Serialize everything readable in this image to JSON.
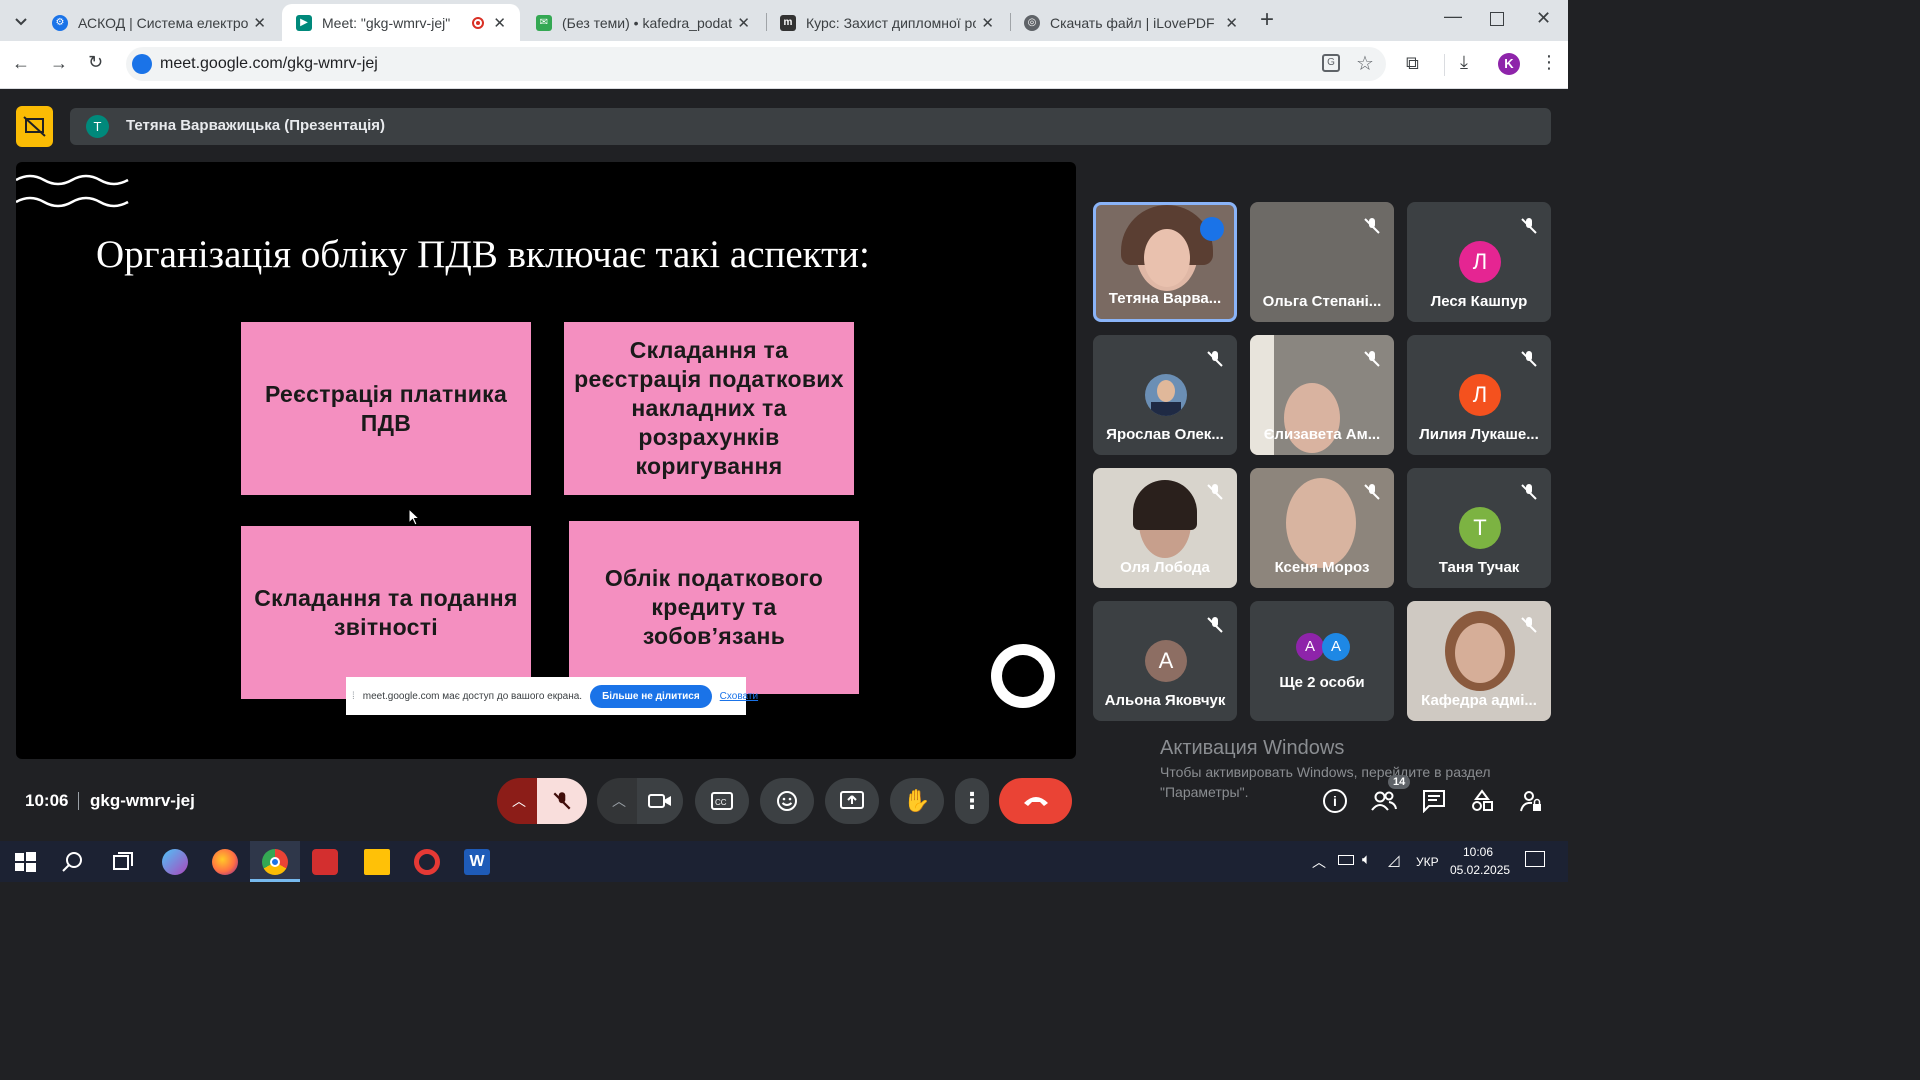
{
  "browser": {
    "tabs": [
      {
        "title": "АСКОД | Система електронног",
        "favicon": "gear-icon",
        "color": "#1a73e8"
      },
      {
        "title": "Meet: \"gkg-wmrv-jej\"",
        "favicon": "meet-icon",
        "color": "#00897b"
      },
      {
        "title": "(Без теми) • kafedra_podatky@",
        "favicon": "mail-icon",
        "color": "#34a853"
      },
      {
        "title": "Курс: Захист дипломної робо",
        "favicon": "moodle-icon",
        "color": "#333333"
      },
      {
        "title": "Скачать файл | iLovePDF",
        "favicon": "globe-icon",
        "color": "#5f6368"
      }
    ],
    "url": "meet.google.com/gkg-wmrv-jej",
    "profile_initial": "K"
  },
  "meet": {
    "presenter_initial": "T",
    "presenter_label": "Тетяна Варважицька (Презентація)",
    "slide": {
      "title": "Організація обліку ПДВ включає такі аспекти:",
      "cards": [
        "Реєстрація платника ПДВ",
        "Складання та реєстрація податкових накладних та розрахунків коригування",
        "Складання та подання звітності",
        "Облік податкового кредиту та зобов’язань"
      ]
    },
    "share_notice": {
      "text": "meet.google.com має доступ до вашого екрана.",
      "stop_label": "Більше не ділитися",
      "hide_label": "Сховати"
    },
    "participants": [
      {
        "name": "Тетяна Варва...",
        "type": "video",
        "speaking": true
      },
      {
        "name": "Ольга Степані...",
        "type": "video",
        "muted": true
      },
      {
        "name": "Леся Кашпур",
        "type": "avatar",
        "initial": "Л",
        "color": "#e52592",
        "muted": true
      },
      {
        "name": "Ярослав Олек...",
        "type": "photo",
        "muted": true
      },
      {
        "name": "Єлизавета Ам...",
        "type": "video",
        "muted": true
      },
      {
        "name": "Лилия Лукаше...",
        "type": "avatar",
        "initial": "Л",
        "color": "#f4511e",
        "muted": true
      },
      {
        "name": "Оля Лобода",
        "type": "video",
        "muted": true
      },
      {
        "name": "Ксеня Мороз",
        "type": "video",
        "muted": true
      },
      {
        "name": "Таня Тучак",
        "type": "avatar",
        "initial": "T",
        "color": "#7cb342",
        "muted": true
      },
      {
        "name": "Альона Яковчук",
        "type": "avatar",
        "initial": "A",
        "color": "#8d6e63",
        "muted": true
      },
      {
        "name": "Ще 2 особи",
        "type": "group",
        "initials": [
          "A",
          "A"
        ]
      },
      {
        "name": "Кафедра адмі...",
        "type": "video",
        "muted": true
      }
    ],
    "time": "10:06",
    "meeting_code": "gkg-wmrv-jej",
    "people_count": "14",
    "windows_activation": {
      "title": "Активация Windows",
      "line1": "Чтобы активировать Windows, перейдите в раздел",
      "line2": "\"Параметры\"."
    }
  },
  "taskbar": {
    "language": "УКР",
    "time": "10:06",
    "date": "05.02.2025"
  }
}
